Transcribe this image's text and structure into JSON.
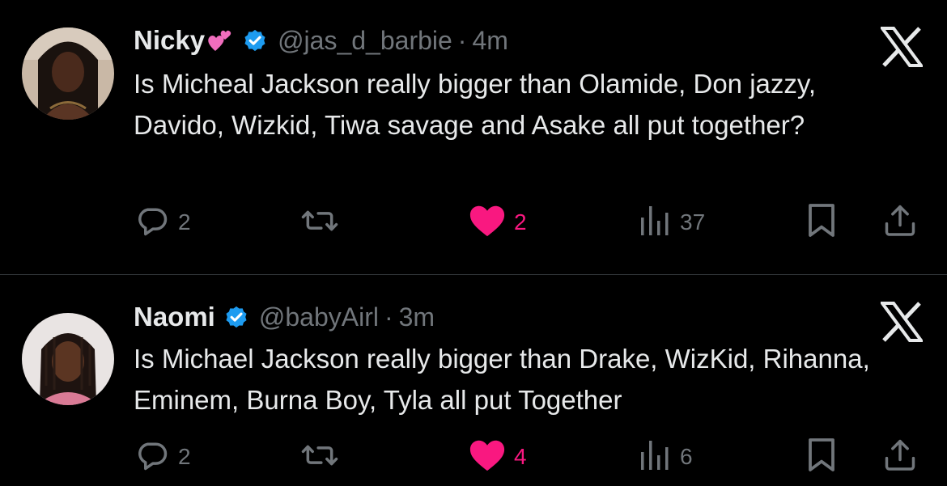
{
  "colors": {
    "background": "#000000",
    "text": "#e7e9ea",
    "muted": "#71767b",
    "like_active": "#f91880",
    "verified": "#1d9bf0",
    "divider": "#2f3336"
  },
  "tweets": [
    {
      "display_name": "Nicky",
      "name_emoji": "💕",
      "verified": true,
      "handle": "@jas_d_barbie",
      "separator": "·",
      "time": "4m",
      "text": "Is Micheal Jackson really bigger than Olamide, Don jazzy, Davido, Wizkid, Tiwa savage and Asake all put together?",
      "replies": "2",
      "retweets": "",
      "likes": "2",
      "liked": true,
      "views": "37",
      "icons": [
        "reply-icon",
        "retweet-icon",
        "heart-icon",
        "views-icon",
        "bookmark-icon",
        "share-icon",
        "x-logo-icon",
        "verified-badge-icon"
      ]
    },
    {
      "display_name": "Naomi",
      "verified": true,
      "handle": "@babyAirl",
      "separator": "·",
      "time": "3m",
      "text": "Is Michael Jackson really bigger than Drake, WizKid, Rihanna, Eminem, Burna Boy, Tyla all put Together",
      "replies": "2",
      "retweets": "",
      "likes": "4",
      "liked": true,
      "views": "6",
      "icons": [
        "reply-icon",
        "retweet-icon",
        "heart-icon",
        "views-icon",
        "bookmark-icon",
        "share-icon",
        "x-logo-icon",
        "verified-badge-icon"
      ]
    }
  ]
}
